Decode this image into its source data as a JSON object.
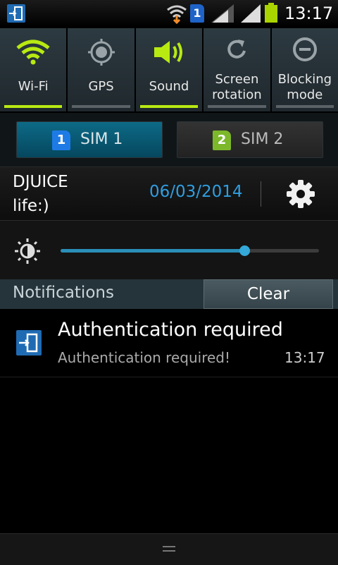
{
  "status_bar": {
    "time": "13:17",
    "sim_indicator": "1",
    "icons": [
      "app-notification-icon",
      "wifi-icon",
      "sim1-icon",
      "signal-icon",
      "signal-icon",
      "battery-icon"
    ]
  },
  "quick_settings": [
    {
      "label": "Wi-Fi",
      "icon": "wifi-icon",
      "on": true
    },
    {
      "label": "GPS",
      "icon": "gps-icon",
      "on": false
    },
    {
      "label": "Sound",
      "icon": "sound-icon",
      "on": true
    },
    {
      "label": "Screen rotation",
      "line1": "Screen",
      "line2": "rotation",
      "icon": "rotation-icon",
      "on": false
    },
    {
      "label": "Blocking mode",
      "line1": "Blocking",
      "line2": "mode",
      "icon": "blocking-icon",
      "on": false
    }
  ],
  "sims": [
    {
      "number": "1",
      "label": "SIM 1",
      "selected": true
    },
    {
      "number": "2",
      "label": "SIM 2",
      "selected": false
    }
  ],
  "carrier": {
    "name": "DJUICE life:)",
    "date": "06/03/2014"
  },
  "brightness": {
    "level": 0.71
  },
  "notifications": {
    "header": "Notifications",
    "clear_label": "Clear",
    "items": [
      {
        "title": "Authentication required",
        "body": "Authentication required!",
        "time": "13:17"
      }
    ]
  },
  "colors": {
    "accent_on": "#b8ea12",
    "date": "#2f9ee0",
    "sim1": "#1e7be6",
    "sim2": "#7cb82a"
  }
}
